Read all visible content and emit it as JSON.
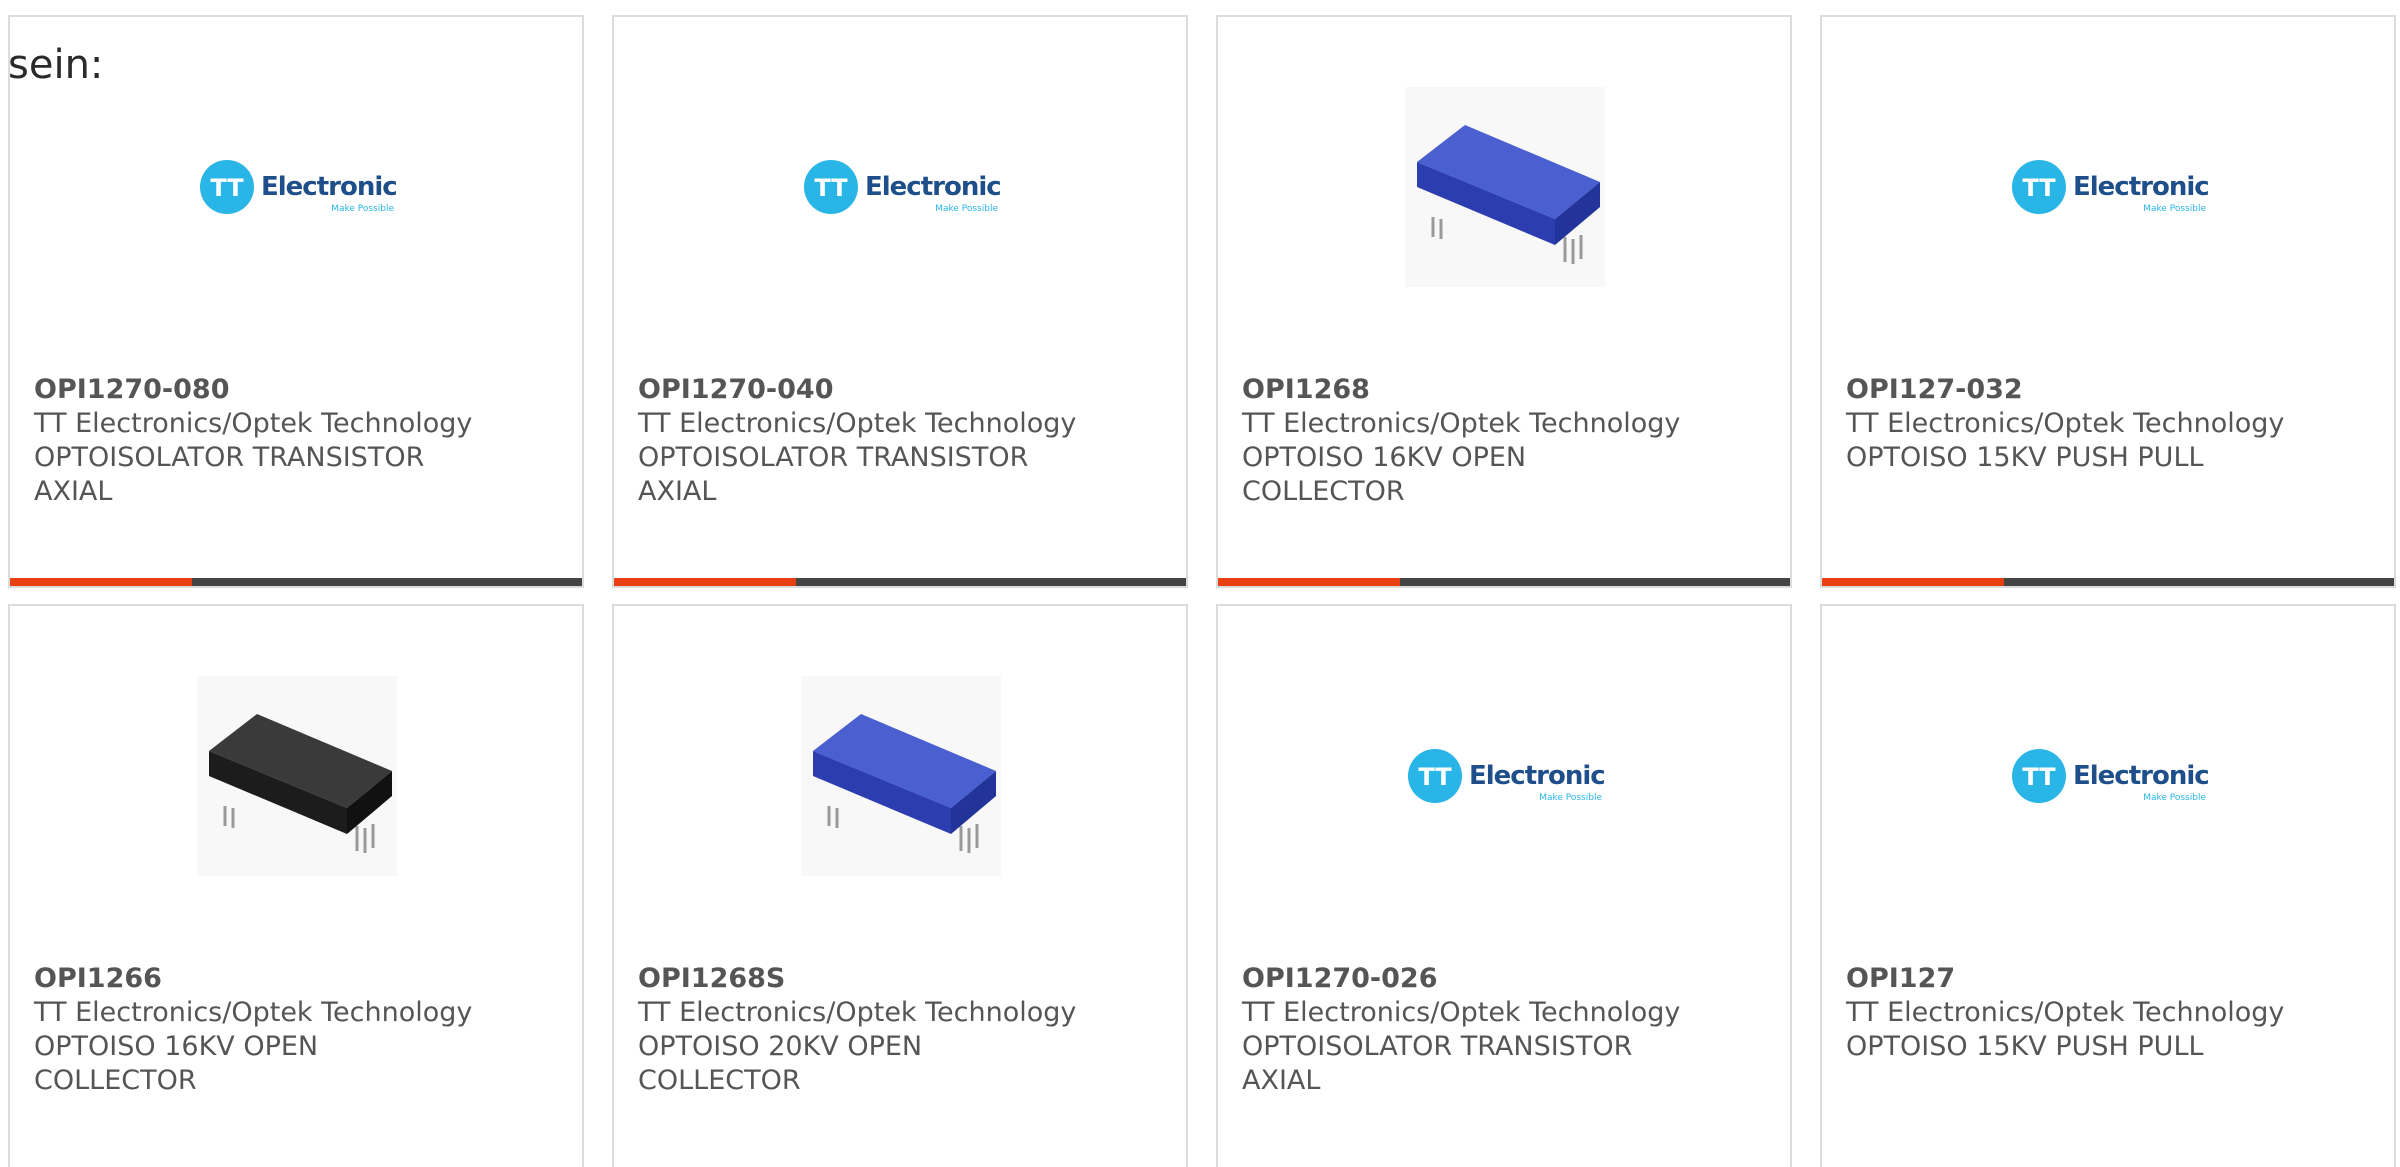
{
  "heading": "sein:",
  "accent_color": "#e8410f",
  "bar_color": "#444444",
  "logo": {
    "symbol": "TT",
    "wordmark": "Electronics",
    "tagline": "Make Possible",
    "color_circle": "#29b6e6",
    "color_text": "#1e4f8a"
  },
  "products": [
    {
      "part": "OPI1270-080",
      "maker": "TT Electronics/Optek Technology",
      "desc": "OPTOISOLATOR TRANSISTOR AXIAL",
      "image": "tt-logo"
    },
    {
      "part": "OPI1270-040",
      "maker": "TT Electronics/Optek Technology",
      "desc": "OPTOISOLATOR TRANSISTOR AXIAL",
      "image": "tt-logo"
    },
    {
      "part": "OPI1268",
      "maker": "TT Electronics/Optek Technology",
      "desc": "OPTOISO 16KV OPEN COLLECTOR",
      "image": "blue-component"
    },
    {
      "part": "OPI127-032",
      "maker": "TT Electronics/Optek Technology",
      "desc": "OPTOISO 15KV PUSH PULL",
      "image": "tt-logo"
    },
    {
      "part": "OPI1266",
      "maker": "TT Electronics/Optek Technology",
      "desc": "OPTOISO 16KV OPEN COLLECTOR",
      "image": "black-component"
    },
    {
      "part": "OPI1268S",
      "maker": "TT Electronics/Optek Technology",
      "desc": "OPTOISO 20KV OPEN COLLECTOR",
      "image": "blue-component"
    },
    {
      "part": "OPI1270-026",
      "maker": "TT Electronics/Optek Technology",
      "desc": "OPTOISOLATOR TRANSISTOR AXIAL",
      "image": "tt-logo"
    },
    {
      "part": "OPI127",
      "maker": "TT Electronics/Optek Technology",
      "desc": "OPTOISO 15KV PUSH PULL",
      "image": "tt-logo"
    }
  ]
}
